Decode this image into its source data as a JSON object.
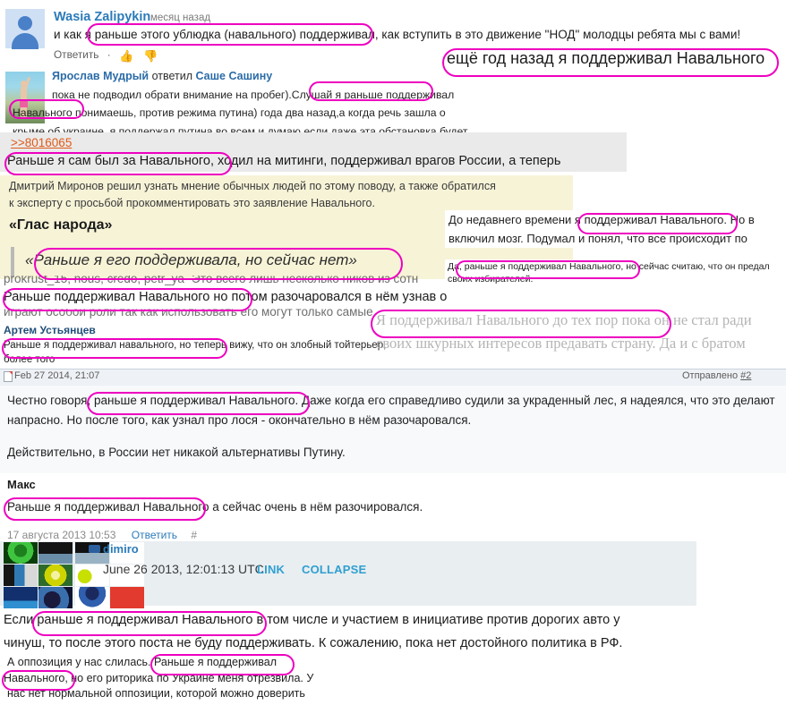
{
  "highlight_color": "#ee00c0",
  "comment_youtube": {
    "author": "Wasia Zalipykin",
    "time": "месяц назад",
    "body": "и как я раньше этого ублюдка (навального) поддерживал, как вступить в это движение \"НОД\" молодцы ребята мы с вами!",
    "reply_label": "Ответить",
    "separator": "·"
  },
  "banner": {
    "text": "ещё год назад я поддерживал Навального"
  },
  "comment_vk": {
    "author": "Ярослав Мудрый",
    "action": "ответил",
    "target": "Саше Сашину",
    "line1": "пока не подводил обрати внимание на пробег).Слушай я раньше поддерживал",
    "line2": "Навального понимаешь, против режима путина) года два назад,а когда речь зашла о",
    "line3": "крыме об украине, я поддержал путина во всем и думаю если даже эта обстановка будет"
  },
  "board_post": {
    "link": ">>8016065",
    "text": "Раньше я сам был за Навального, ходил на митинги, поддерживал врагов России, а теперь"
  },
  "article": {
    "line1": "Дмитрий Миронов решил узнать мнение обычных людей по этому поводу, а также обратился",
    "line2": "к эксперту с просьбой прокомментировать это заявление Навального.",
    "heading": "«Глас народа»",
    "quote": "«Раньше я его поддерживала, но сейчас нет»"
  },
  "white_quote_right": {
    "line1": "До недавнего времени я поддерживал Навального. Но в",
    "line2": "включил мозг. Подумал и понял, что все происходит по"
  },
  "small_quote_right": {
    "line1": "Да, раньше я поддерживал Навального, но сейчас считаю, что он предал",
    "line2": "своих избирателей."
  },
  "clipped": {
    "line_top": "prokrust_15, nous, credo, petr_ya- Это всего лишь несколько ников из сотн",
    "line_main": "Раньше поддерживал Навального но потом разочаровался в нём узнав о",
    "line_bottom": "играют особой роли так как использовать его могут только самые"
  },
  "comment_artem": {
    "author": "Артем Устьянцев",
    "line1": "Раньше я поддерживал навального, но теперь вижу, что он злобный тойтерьер,",
    "line2": "более того"
  },
  "serif_quote": {
    "line1": "Я поддерживал Навального до тех пор пока он не стал ради",
    "line2": "своих шкурных интересов предавать страну. Да и с братом"
  },
  "forum_post": {
    "date": "Feb 27 2014, 21:07",
    "sent_label": "Отправлено",
    "sent_number": "#2",
    "line1": "Честно говоря, раньше я поддерживал Навального. Даже когда его справедливо судили за украденный лес, я надеялся, что это делают",
    "line2": "напрасно. Но после того, как узнал про лося - окончательно в нём разочаровался.",
    "line3": "Действительно, в России нет никакой альтернативы Путину."
  },
  "comment_maks": {
    "author": "Макс",
    "body": "Раньше я поддерживал Навального а сейчас очень в нём разочировался.",
    "date": "17 августа 2013 10:53",
    "reply_label": "Ответить",
    "hash": "#"
  },
  "lj_post": {
    "user": "dimiro",
    "date": "June 26 2013, 12:01:13 UTC",
    "link_label": "LINK",
    "collapse_label": "COLLAPSE",
    "line1": "Если раньше я поддерживал Навального в том числе и участием в инициативе против дорогих авто у",
    "line2": "чинуш, то после этого поста не буду поддерживать. К сожалению, пока нет достойного политика в РФ."
  },
  "last_comment": {
    "line1": "А оппозиция у нас слилась. Раньше я поддерживал",
    "line2": "Навального, но его риторика по Украине меня отрезвила. У",
    "line3": "нас нет нормальной оппозиции, которой можно доверить"
  }
}
